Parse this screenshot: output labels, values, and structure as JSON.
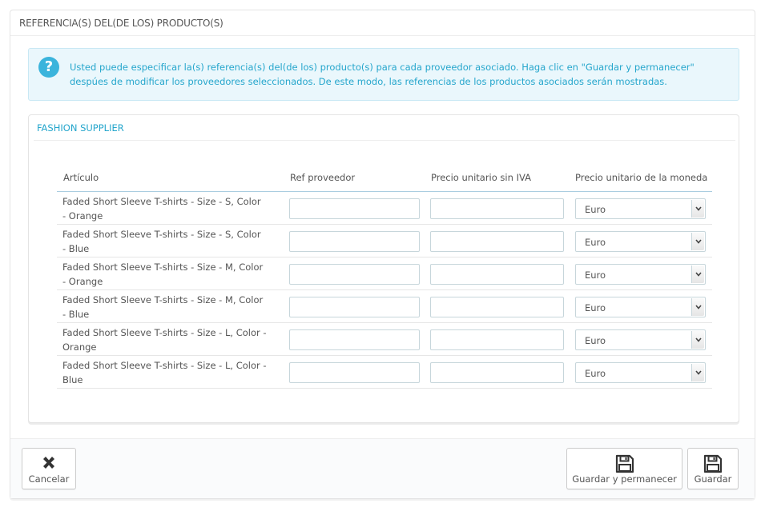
{
  "panel": {
    "title": "REFERENCIA(S) DEL(DE LOS) PRODUCTO(S)"
  },
  "alert": {
    "icon": "question-icon",
    "text": "Usted puede especificar la(s) referencia(s) del(de los) producto(s) para cada proveedor asociado. Haga clic en \"Guardar y permanecer\" despúes de modificar los proveedores seleccionados. De este modo, las referencias de los productos asociados serán mostradas."
  },
  "supplier": {
    "name": "FASHION SUPPLIER",
    "columns": {
      "article": "Artículo",
      "ref": "Ref proveedor",
      "price": "Precio unitario sin IVA",
      "currency": "Precio unitario de la moneda"
    },
    "rows": [
      {
        "label": "Faded Short Sleeve T-shirts - Size - S, Color - Orange",
        "ref": "",
        "price": "",
        "currency": "Euro"
      },
      {
        "label": "Faded Short Sleeve T-shirts - Size - S, Color - Blue",
        "ref": "",
        "price": "",
        "currency": "Euro"
      },
      {
        "label": "Faded Short Sleeve T-shirts - Size - M, Color - Orange",
        "ref": "",
        "price": "",
        "currency": "Euro"
      },
      {
        "label": "Faded Short Sleeve T-shirts - Size - M, Color - Blue",
        "ref": "",
        "price": "",
        "currency": "Euro"
      },
      {
        "label": "Faded Short Sleeve T-shirts - Size - L, Color - Orange",
        "ref": "",
        "price": "",
        "currency": "Euro"
      },
      {
        "label": "Faded Short Sleeve T-shirts - Size - L, Color - Blue",
        "ref": "",
        "price": "",
        "currency": "Euro"
      }
    ]
  },
  "footer": {
    "cancel_label": "Cancelar",
    "save_stay_label": "Guardar y permanecer",
    "save_label": "Guardar"
  },
  "colors": {
    "accent": "#25a6cc",
    "alert_bg": "#eaf7fc"
  }
}
